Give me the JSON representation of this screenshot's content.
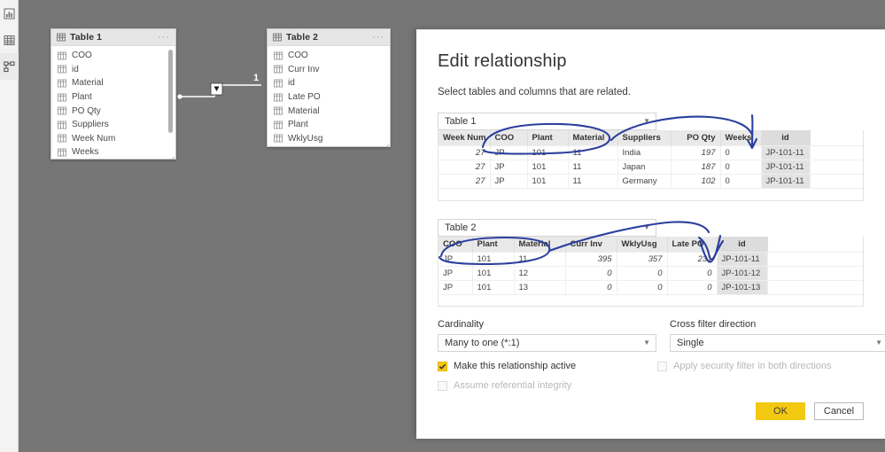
{
  "rail": {
    "items": [
      {
        "name": "report-view-icon",
        "label": "Report view"
      },
      {
        "name": "data-view-icon",
        "label": "Data view"
      },
      {
        "name": "model-view-icon",
        "label": "Model view"
      }
    ]
  },
  "canvas": {
    "cards": [
      {
        "title": "Table 1",
        "menu": "···",
        "fields": [
          "COO",
          "id",
          "Material",
          "Plant",
          "PO Qty",
          "Suppliers",
          "Week Num",
          "Weeks"
        ]
      },
      {
        "title": "Table 2",
        "menu": "···",
        "fields": [
          "COO",
          "Curr Inv",
          "id",
          "Late PO",
          "Material",
          "Plant",
          "WklyUsg"
        ]
      }
    ],
    "relationship": {
      "cardinality_label": "1"
    }
  },
  "dialog": {
    "title": "Edit relationship",
    "subtitle": "Select tables and columns that are related.",
    "table1": {
      "selected": "Table 1",
      "columns": [
        "Week Num",
        "COO",
        "Plant",
        "Material",
        "Suppliers",
        "PO Qty",
        "Weeks",
        "id"
      ],
      "selected_column": "id",
      "rows": [
        [
          "27",
          "JP",
          "101",
          "11",
          "India",
          "197",
          "0",
          "JP-101-11"
        ],
        [
          "27",
          "JP",
          "101",
          "11",
          "Japan",
          "187",
          "0",
          "JP-101-11"
        ],
        [
          "27",
          "JP",
          "101",
          "11",
          "Germany",
          "102",
          "0",
          "JP-101-11"
        ]
      ]
    },
    "table2": {
      "selected": "Table 2",
      "columns": [
        "COO",
        "Plant",
        "Material",
        "Curr Inv",
        "WklyUsg",
        "Late PO",
        "id"
      ],
      "selected_column": "id",
      "rows": [
        [
          "JP",
          "101",
          "11",
          "395",
          "357",
          "231",
          "JP-101-11"
        ],
        [
          "JP",
          "101",
          "12",
          "0",
          "0",
          "0",
          "JP-101-12"
        ],
        [
          "JP",
          "101",
          "13",
          "0",
          "0",
          "0",
          "JP-101-13"
        ]
      ]
    },
    "cardinality": {
      "label": "Cardinality",
      "value": "Many to one (*:1)"
    },
    "cross_filter": {
      "label": "Cross filter direction",
      "value": "Single"
    },
    "checkboxes": {
      "active": {
        "label": "Make this relationship active",
        "checked": true
      },
      "security": {
        "label": "Apply security filter in both directions",
        "checked": false
      },
      "referential": {
        "label": "Assume referential integrity",
        "checked": false
      }
    },
    "buttons": {
      "ok": "OK",
      "cancel": "Cancel"
    }
  },
  "colors": {
    "accent": "#f2c811",
    "canvas": "#767676",
    "ink": "#2b3f9e",
    "header": "#e9e9e9"
  }
}
